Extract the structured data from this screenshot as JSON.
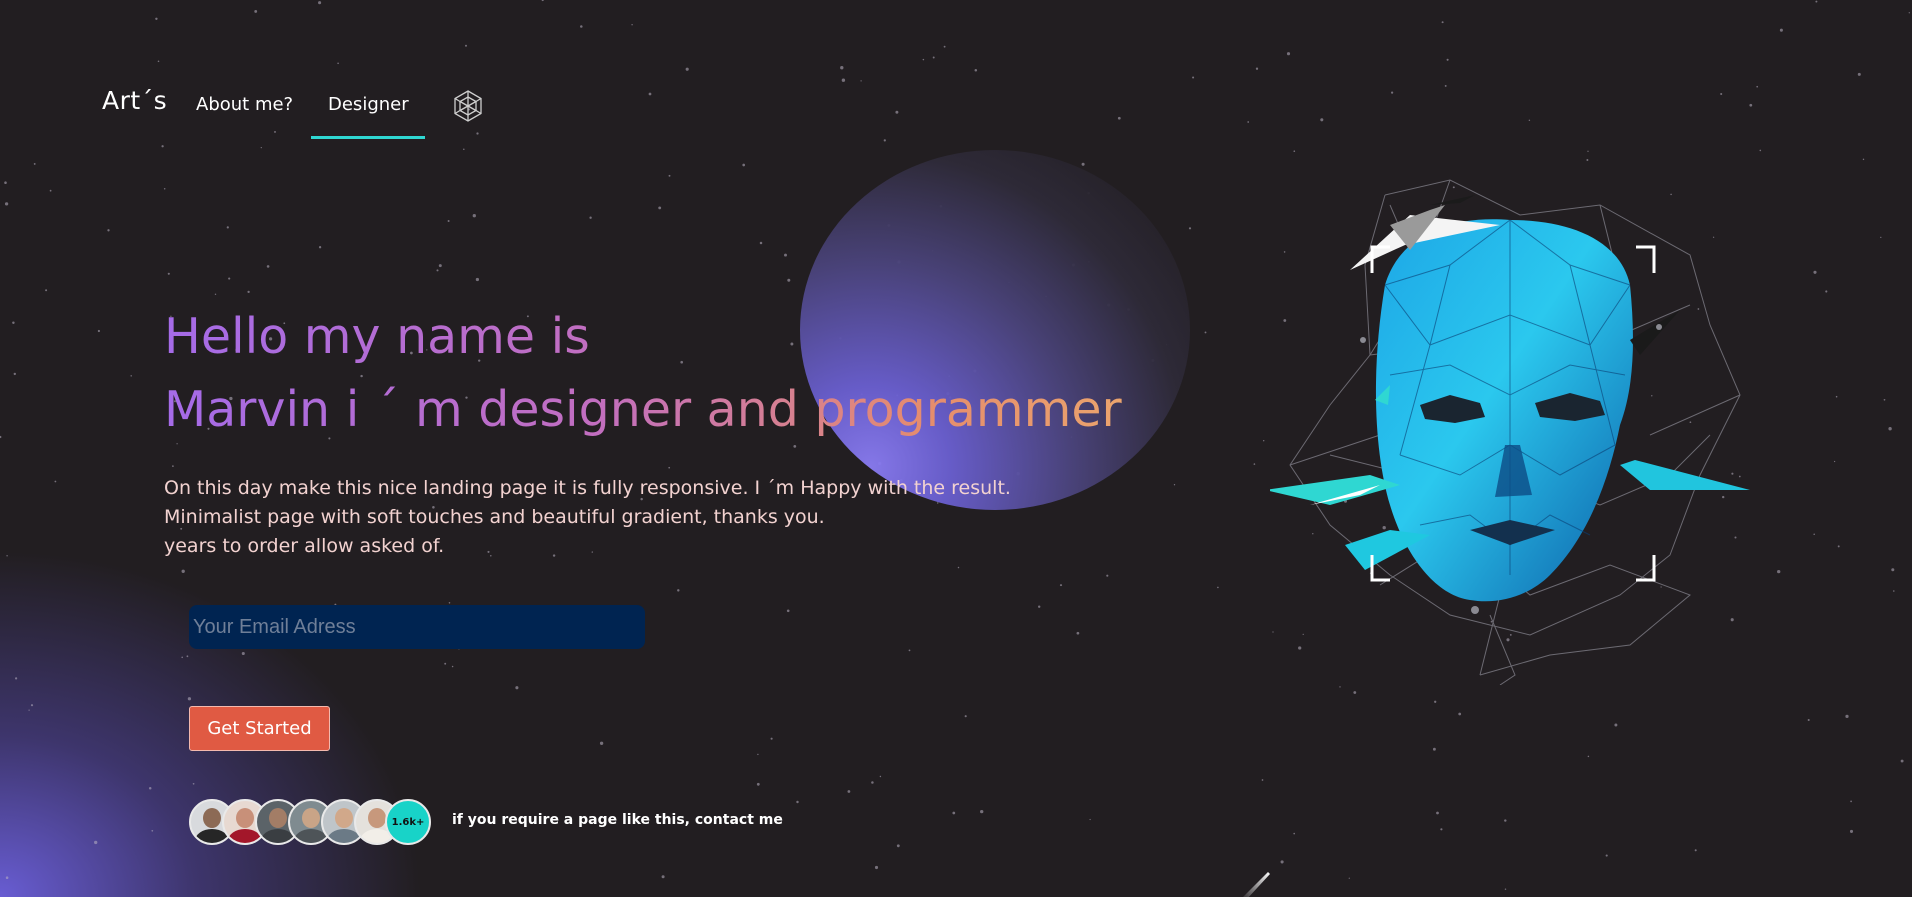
{
  "nav": {
    "brand": "Art´s",
    "links": [
      "About me?",
      "Designer"
    ],
    "active_link": "Designer",
    "icon": "cube-network-icon"
  },
  "hero": {
    "line1": "Hello my name is",
    "line2": "Marvin i ´ m designer and programmer",
    "description": [
      "On this day make this nice landing page it is fully responsive. I ´m Happy with the result.",
      "Minimalist page with soft touches and beautiful gradient, thanks you.",
      "years to order allow asked of."
    ],
    "email_placeholder": "Your Email Adress",
    "email_value": "",
    "cta_label": "Get Started",
    "count_badge": "1.6k+",
    "contact_text": "if you require a page like this, contact me"
  },
  "colors": {
    "background": "#221e21",
    "accent": "#2fd7d2",
    "cta": "#e05a43",
    "input": "#002451",
    "gradient_start": "#a56be8",
    "gradient_end": "#eba46d"
  },
  "illustration": "low-poly-face-icon"
}
